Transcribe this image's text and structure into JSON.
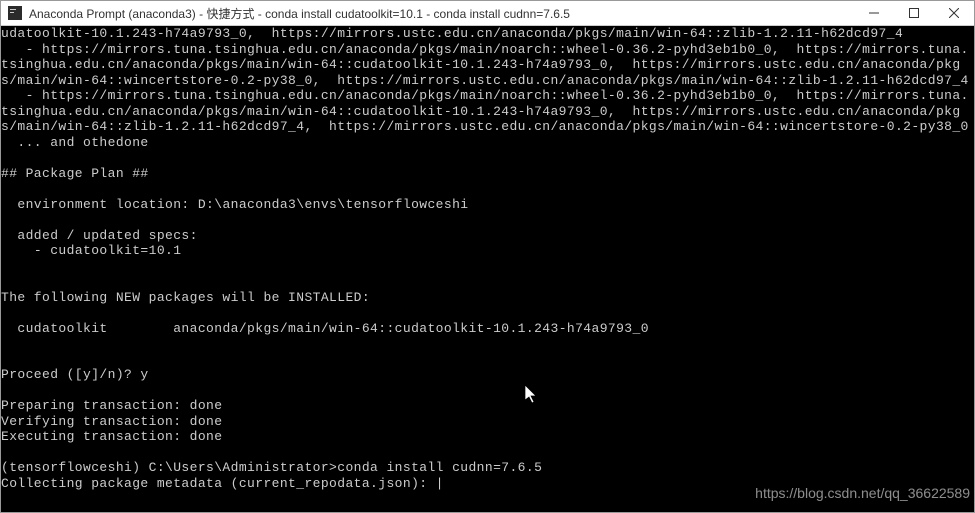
{
  "titlebar": {
    "title": "Anaconda Prompt (anaconda3) - 快捷方式 - conda  install cudatoolkit=10.1 - conda  install cudnn=7.6.5"
  },
  "terminal": {
    "lines": [
      "udatoolkit-10.1.243-h74a9793_0,  https://mirrors.ustc.edu.cn/anaconda/pkgs/main/win-64::zlib-1.2.11-h62dcd97_4",
      "   - https://mirrors.tuna.tsinghua.edu.cn/anaconda/pkgs/main/noarch::wheel-0.36.2-pyhd3eb1b0_0,  https://mirrors.tuna.tsinghua.edu.cn/anaconda/pkgs/main/win-64::cudatoolkit-10.1.243-h74a9793_0,  https://mirrors.ustc.edu.cn/anaconda/pkgs/main/win-64::wincertstore-0.2-py38_0,  https://mirrors.ustc.edu.cn/anaconda/pkgs/main/win-64::zlib-1.2.11-h62dcd97_4",
      "   - https://mirrors.tuna.tsinghua.edu.cn/anaconda/pkgs/main/noarch::wheel-0.36.2-pyhd3eb1b0_0,  https://mirrors.tuna.tsinghua.edu.cn/anaconda/pkgs/main/win-64::cudatoolkit-10.1.243-h74a9793_0,  https://mirrors.ustc.edu.cn/anaconda/pkgs/main/win-64::zlib-1.2.11-h62dcd97_4,  https://mirrors.ustc.edu.cn/anaconda/pkgs/main/win-64::wincertstore-0.2-py38_0",
      "  ... and othedone",
      "",
      "## Package Plan ##",
      "",
      "  environment location: D:\\anaconda3\\envs\\tensorflowceshi",
      "",
      "  added / updated specs:",
      "    - cudatoolkit=10.1",
      "",
      "",
      "The following NEW packages will be INSTALLED:",
      "",
      "  cudatoolkit        anaconda/pkgs/main/win-64::cudatoolkit-10.1.243-h74a9793_0",
      "",
      "",
      "Proceed ([y]/n)? y",
      "",
      "Preparing transaction: done",
      "Verifying transaction: done",
      "Executing transaction: done",
      "",
      "(tensorflowceshi) C:\\Users\\Administrator>conda install cudnn=7.6.5",
      "Collecting package metadata (current_repodata.json): |"
    ]
  },
  "watermark": "https://blog.csdn.net/qq_36622589"
}
